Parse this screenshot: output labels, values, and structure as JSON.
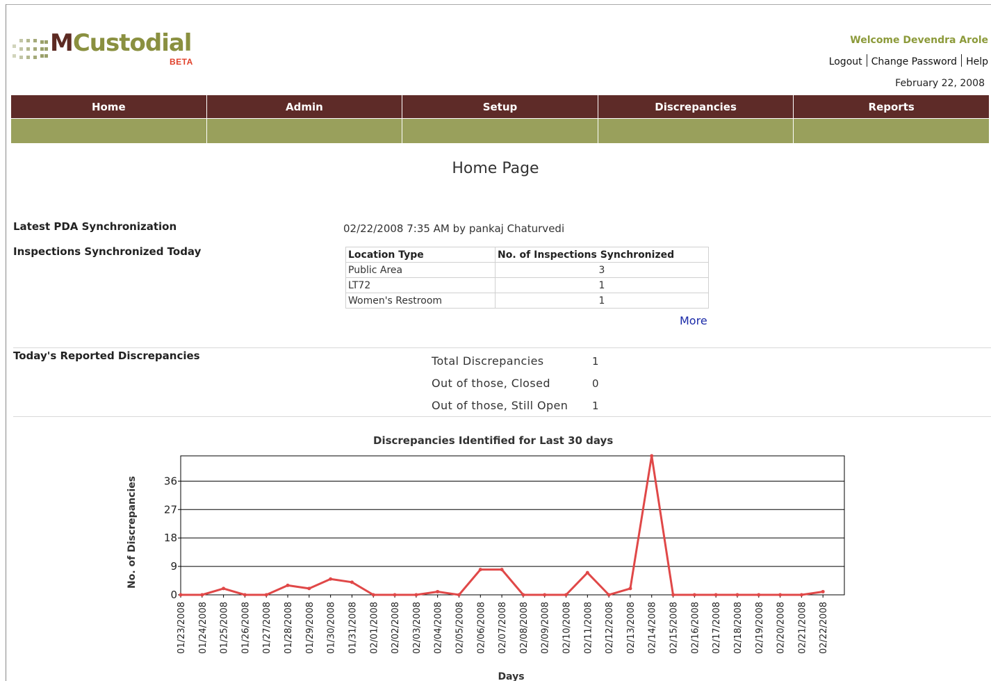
{
  "header": {
    "logo_main": "Custodial",
    "logo_m": "M",
    "logo_beta": "BETA",
    "welcome": "Welcome Devendra Arole",
    "links": {
      "logout": "Logout",
      "change_password": "Change Password",
      "help": "Help"
    },
    "date": "February 22, 2008"
  },
  "nav": {
    "items": [
      {
        "label": "Home"
      },
      {
        "label": "Admin"
      },
      {
        "label": "Setup"
      },
      {
        "label": "Discrepancies"
      },
      {
        "label": "Reports"
      }
    ]
  },
  "page": {
    "title": "Home Page"
  },
  "sync": {
    "label": "Latest PDA Synchronization",
    "value": "02/22/2008 7:35 AM by pankaj Chaturvedi"
  },
  "inspections": {
    "label": "Inspections Synchronized Today",
    "headers": {
      "location_type": "Location Type",
      "count": "No. of Inspections Synchronized"
    },
    "rows": [
      {
        "location": "Public Area",
        "count": "3"
      },
      {
        "location": "LT72",
        "count": "1"
      },
      {
        "location": "Women's Restroom",
        "count": "1"
      }
    ],
    "more_link": "More"
  },
  "discrepancies": {
    "label": "Today's Reported Discrepancies",
    "rows": [
      {
        "label": "Total Discrepancies",
        "value": "1"
      },
      {
        "label": "Out of those, Closed",
        "value": "0"
      },
      {
        "label": "Out of those, Still Open",
        "value": "1"
      }
    ]
  },
  "chart_data": {
    "type": "line",
    "title": "Discrepancies Identified for Last 30 days",
    "xlabel": "Days",
    "ylabel": "No. of Discrepancies",
    "ylim": [
      0,
      44
    ],
    "yticks": [
      0,
      9,
      18,
      27,
      36
    ],
    "grid": true,
    "line_color": "#e04848",
    "categories": [
      "01/23/2008",
      "01/24/2008",
      "01/25/2008",
      "01/26/2008",
      "01/27/2008",
      "01/28/2008",
      "01/29/2008",
      "01/30/2008",
      "01/31/2008",
      "02/01/2008",
      "02/02/2008",
      "02/03/2008",
      "02/04/2008",
      "02/05/2008",
      "02/06/2008",
      "02/07/2008",
      "02/08/2008",
      "02/09/2008",
      "02/10/2008",
      "02/11/2008",
      "02/12/2008",
      "02/13/2008",
      "02/14/2008",
      "02/15/2008",
      "02/16/2008",
      "02/17/2008",
      "02/18/2008",
      "02/19/2008",
      "02/20/2008",
      "02/21/2008",
      "02/22/2008"
    ],
    "values": [
      0,
      0,
      2,
      0,
      0,
      3,
      2,
      5,
      4,
      0,
      0,
      0,
      1,
      0,
      8,
      8,
      0,
      0,
      0,
      7,
      0,
      2,
      44,
      0,
      0,
      0,
      0,
      0,
      0,
      0,
      1
    ]
  }
}
